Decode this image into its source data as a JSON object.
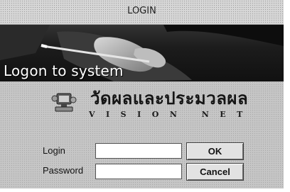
{
  "window": {
    "title": "LOGIN"
  },
  "banner": {
    "text": "Logon to system"
  },
  "logo": {
    "icon": "computer-icon",
    "thai_name": "วัดผลและประมวลผล",
    "latin_name": "VISION NET"
  },
  "form": {
    "login_label": "Login",
    "login_value": "",
    "password_label": "Password",
    "password_value": ""
  },
  "buttons": {
    "ok_label": "OK",
    "cancel_label": "Cancel"
  }
}
